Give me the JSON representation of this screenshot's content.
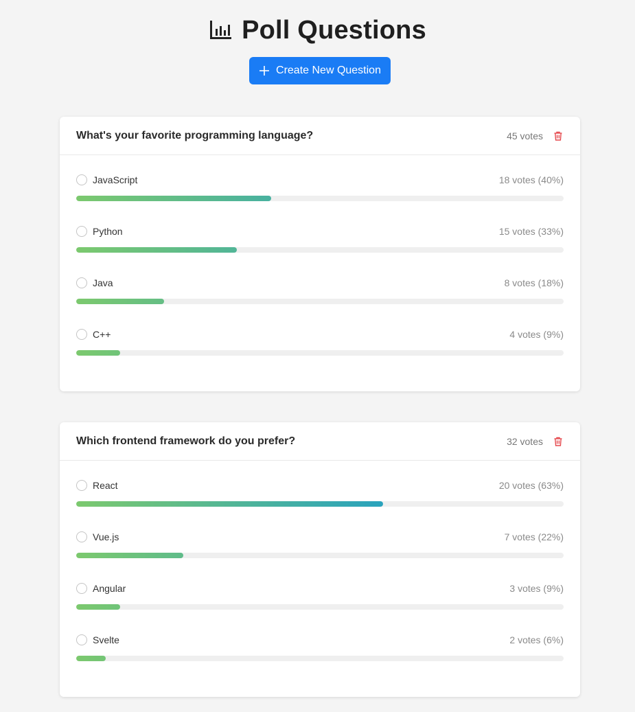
{
  "page": {
    "title": "Poll Questions",
    "title_icon": "bar-chart-icon",
    "create_button_label": "Create New Question",
    "create_button_icon": "plus-icon",
    "accent_color": "#1a7cf5"
  },
  "polls": [
    {
      "question": "What's your favorite programming language?",
      "total_votes": "45 votes",
      "delete_icon": "trash-icon",
      "options": [
        {
          "label": "JavaScript",
          "stats": "18 votes (40%)",
          "percent": 40
        },
        {
          "label": "Python",
          "stats": "15 votes (33%)",
          "percent": 33
        },
        {
          "label": "Java",
          "stats": "8 votes (18%)",
          "percent": 18
        },
        {
          "label": "C++",
          "stats": "4 votes (9%)",
          "percent": 9
        }
      ]
    },
    {
      "question": "Which frontend framework do you prefer?",
      "total_votes": "32 votes",
      "delete_icon": "trash-icon",
      "options": [
        {
          "label": "React",
          "stats": "20 votes (63%)",
          "percent": 63
        },
        {
          "label": "Vue.js",
          "stats": "7 votes (22%)",
          "percent": 22
        },
        {
          "label": "Angular",
          "stats": "3 votes (9%)",
          "percent": 9
        },
        {
          "label": "Svelte",
          "stats": "2 votes (6%)",
          "percent": 6
        }
      ]
    }
  ],
  "colors": {
    "bar_start": "#7cc96e",
    "bar_end": "#2aa3bd",
    "delete": "#e5484d"
  }
}
